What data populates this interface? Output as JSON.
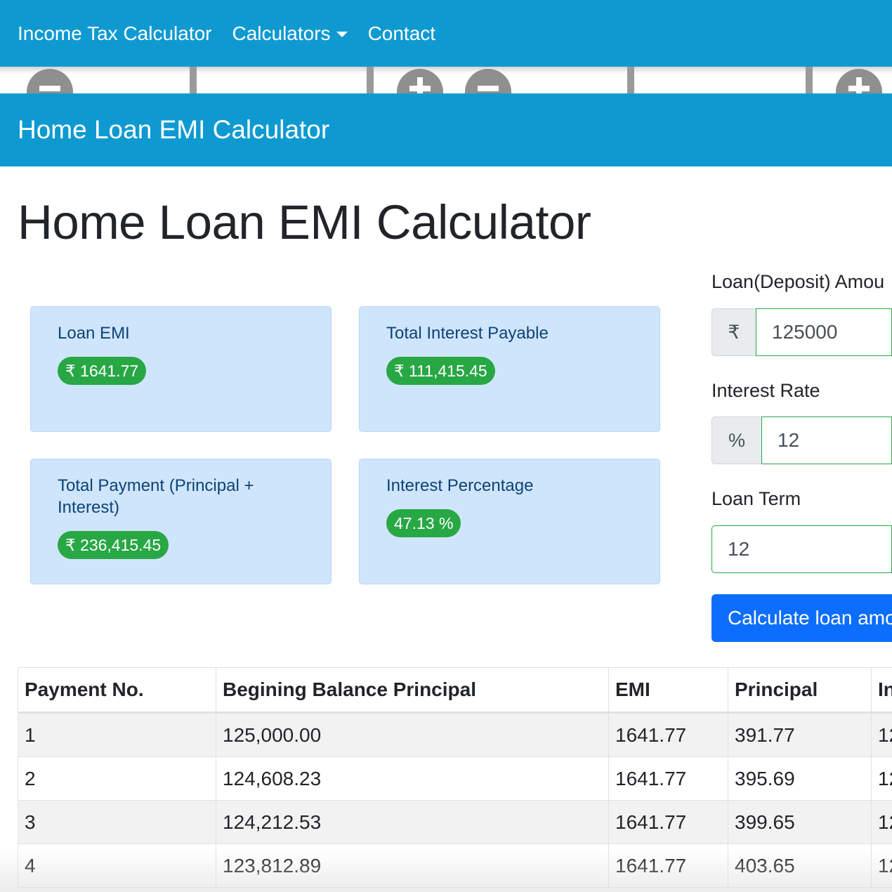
{
  "nav": {
    "items": [
      {
        "label": "Income Tax Calculator"
      },
      {
        "label": "Calculators"
      },
      {
        "label": "Contact"
      }
    ]
  },
  "banner": {
    "title": "Home Loan EMI Calculator"
  },
  "page": {
    "title": "Home Loan EMI Calculator"
  },
  "results": {
    "loan_emi": {
      "label": "Loan EMI",
      "value": "₹ 1641.77"
    },
    "total_interest": {
      "label": "Total Interest Payable",
      "value": "₹ 111,415.45"
    },
    "total_payment": {
      "label": "Total Payment (Principal + Interest)",
      "value": "₹ 236,415.45"
    },
    "interest_percentage": {
      "label": "Interest Percentage",
      "value": "47.13 %"
    }
  },
  "form": {
    "loan_amount": {
      "label": "Loan(Deposit) Amou",
      "prefix": "₹",
      "value": "125000"
    },
    "interest_rate": {
      "label": "Interest Rate",
      "prefix": "%",
      "value": "12"
    },
    "loan_term": {
      "label": "Loan Term",
      "value": "12"
    },
    "submit_label": "Calculate loan amo"
  },
  "table": {
    "headers": [
      "Payment No.",
      "Begining Balance Principal",
      "EMI",
      "Principal",
      "In"
    ],
    "rows": [
      [
        "1",
        "125,000.00",
        "1641.77",
        "391.77",
        "12"
      ],
      [
        "2",
        "124,608.23",
        "1641.77",
        "395.69",
        "12"
      ],
      [
        "3",
        "124,212.53",
        "1641.77",
        "399.65",
        "12"
      ],
      [
        "4",
        "123,812.89",
        "1641.77",
        "403.65",
        "12"
      ]
    ]
  },
  "colors": {
    "navbar": "#0e9ad1",
    "card_bg": "#cfe5fc",
    "badge": "#28a745",
    "button": "#0d6efd"
  }
}
